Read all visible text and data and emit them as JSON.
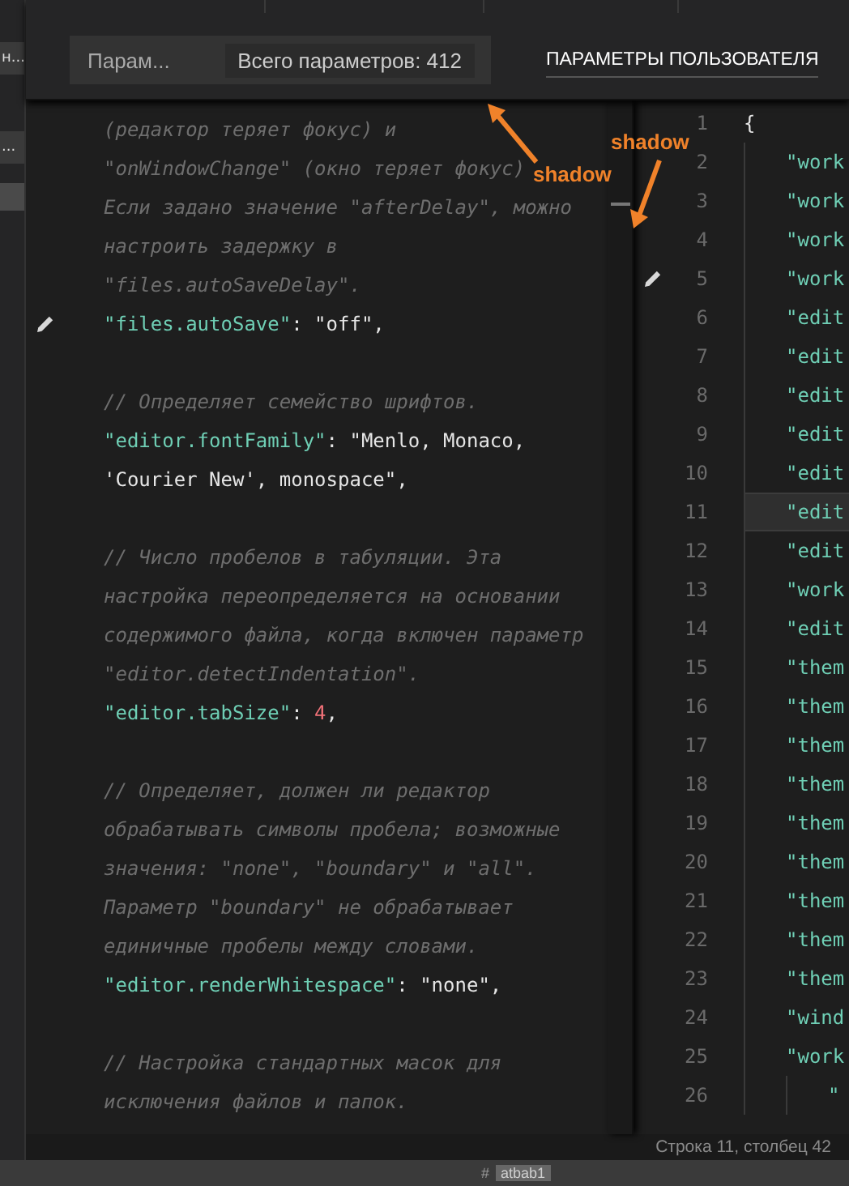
{
  "sidebar": {
    "items": [
      {
        "label": "н...",
        "selected": false
      },
      {
        "label": "...",
        "selected": false
      },
      {
        "selected": true
      }
    ]
  },
  "header": {
    "search": {
      "placeholder": "Парам...",
      "count_badge": "Всего параметров: 412"
    },
    "title": "ПАРАМЕТРЫ ПОЛЬЗОВАТЕЛЯ"
  },
  "default_settings": {
    "lines": [
      {
        "kind": "comment",
        "text": "(редактор теряет фокус) и"
      },
      {
        "kind": "comment",
        "text": "\"onWindowChange\" (окно теряет фокус)"
      },
      {
        "kind": "comment",
        "text": "Если задано значение \"afterDelay\", можно"
      },
      {
        "kind": "comment",
        "text": "настроить задержку в"
      },
      {
        "kind": "comment",
        "text": "\"files.autoSaveDelay\"."
      },
      {
        "kind": "code",
        "edit_icon": true,
        "parts": [
          {
            "kind": "key",
            "text": "\"files.autoSave\""
          },
          {
            "kind": "punct",
            "text": ": "
          },
          {
            "kind": "string",
            "text": "\"off\","
          }
        ]
      },
      {
        "kind": "blank"
      },
      {
        "kind": "comment",
        "text": "// Определяет семейство шрифтов."
      },
      {
        "kind": "code",
        "edit_icon": false,
        "parts": [
          {
            "kind": "key",
            "text": "\"editor.fontFamily\""
          },
          {
            "kind": "punct",
            "text": ": "
          },
          {
            "kind": "string",
            "text": "\"Menlo, Monaco,"
          }
        ]
      },
      {
        "kind": "code",
        "edit_icon": false,
        "parts": [
          {
            "kind": "string",
            "text": "'Courier New', monospace\","
          }
        ]
      },
      {
        "kind": "blank"
      },
      {
        "kind": "comment",
        "text": "// Число пробелов в табуляции. Эта"
      },
      {
        "kind": "comment",
        "text": "настройка переопределяется на основании"
      },
      {
        "kind": "comment",
        "text": "содержимого файла, когда включен параметр"
      },
      {
        "kind": "comment",
        "text": "\"editor.detectIndentation\"."
      },
      {
        "kind": "code",
        "edit_icon": false,
        "parts": [
          {
            "kind": "key",
            "text": "\"editor.tabSize\""
          },
          {
            "kind": "punct",
            "text": ": "
          },
          {
            "kind": "number",
            "text": "4"
          },
          {
            "kind": "punct",
            "text": ","
          }
        ]
      },
      {
        "kind": "blank"
      },
      {
        "kind": "comment",
        "text": "// Определяет, должен ли редактор"
      },
      {
        "kind": "comment",
        "text": "обрабатывать символы пробела; возможные"
      },
      {
        "kind": "comment",
        "text": "значения: \"none\", \"boundary\" и \"all\"."
      },
      {
        "kind": "comment",
        "text": "Параметр \"boundary\" не обрабатывает"
      },
      {
        "kind": "comment",
        "text": "единичные пробелы между словами."
      },
      {
        "kind": "code",
        "edit_icon": false,
        "parts": [
          {
            "kind": "key",
            "text": "\"editor.renderWhitespace\""
          },
          {
            "kind": "punct",
            "text": ": "
          },
          {
            "kind": "string",
            "text": "\"none\","
          }
        ]
      },
      {
        "kind": "blank"
      },
      {
        "kind": "comment",
        "text": "// Настройка стандартных масок для"
      },
      {
        "kind": "comment",
        "text": "исключения файлов и папок."
      }
    ]
  },
  "user_settings": {
    "lines": [
      {
        "number": "1",
        "text": "{",
        "selected": false,
        "edit_icon": false,
        "children": [
          {
            "number": "2",
            "text": "\"work",
            "selected": false,
            "edit_icon": false
          },
          {
            "number": "3",
            "text": "\"work",
            "selected": false,
            "edit_icon": false
          },
          {
            "number": "4",
            "text": "\"work",
            "selected": false,
            "edit_icon": false
          },
          {
            "number": "5",
            "text": "\"work",
            "selected": false,
            "edit_icon": true
          },
          {
            "number": "6",
            "text": "\"edit",
            "selected": false,
            "edit_icon": false
          },
          {
            "number": "7",
            "text": "\"edit",
            "selected": false,
            "edit_icon": false
          },
          {
            "number": "8",
            "text": "\"edit",
            "selected": false,
            "edit_icon": false
          },
          {
            "number": "9",
            "text": "\"edit",
            "selected": false,
            "edit_icon": false
          },
          {
            "number": "10",
            "text": "\"edit",
            "selected": false,
            "edit_icon": false
          },
          {
            "number": "11",
            "text": "\"edit",
            "selected": true,
            "edit_icon": false
          },
          {
            "number": "12",
            "text": "\"edit",
            "selected": false,
            "edit_icon": false
          },
          {
            "number": "13",
            "text": "\"work",
            "selected": false,
            "edit_icon": false
          },
          {
            "number": "14",
            "text": "\"edit",
            "selected": false,
            "edit_icon": false
          },
          {
            "number": "15",
            "text": "\"them",
            "selected": false,
            "edit_icon": false
          },
          {
            "number": "16",
            "text": "\"them",
            "selected": false,
            "edit_icon": false
          },
          {
            "number": "17",
            "text": "\"them",
            "selected": false,
            "edit_icon": false
          },
          {
            "number": "18",
            "text": "\"them",
            "selected": false,
            "edit_icon": false
          },
          {
            "number": "19",
            "text": "\"them",
            "selected": false,
            "edit_icon": false
          },
          {
            "number": "20",
            "text": "\"them",
            "selected": false,
            "edit_icon": false
          },
          {
            "number": "21",
            "text": "\"them",
            "selected": false,
            "edit_icon": false
          },
          {
            "number": "22",
            "text": "\"them",
            "selected": false,
            "edit_icon": false
          },
          {
            "number": "23",
            "text": "\"them",
            "selected": false,
            "edit_icon": false
          },
          {
            "number": "24",
            "text": "\"wind",
            "selected": false,
            "edit_icon": false
          },
          {
            "number": "25",
            "text": "\"work",
            "selected": false,
            "edit_icon": false,
            "children": [
              {
                "number": "26",
                "text": "\"",
                "selected": false,
                "edit_icon": false
              }
            ]
          }
        ]
      }
    ]
  },
  "status_bar": {
    "position": "Строка 11, столбец 42"
  },
  "bottom_strip": {
    "hash": "#",
    "tag": "atbab1"
  },
  "annotations": [
    {
      "text": "shadow"
    },
    {
      "text": "shadow"
    }
  ]
}
